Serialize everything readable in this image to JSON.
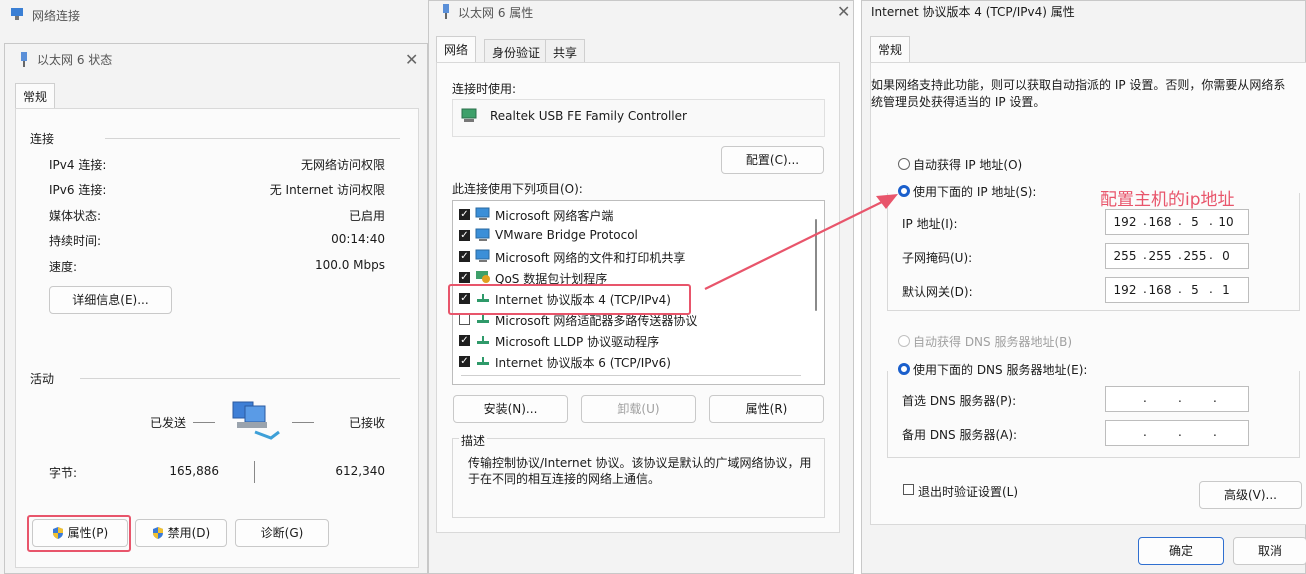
{
  "bg_window": {
    "title": "网络连接"
  },
  "status_window": {
    "title": "以太网 6 状态",
    "tab": "常规",
    "connection": {
      "heading": "连接",
      "rows": [
        {
          "label": "IPv4 连接:",
          "value": "无网络访问权限"
        },
        {
          "label": "IPv6 连接:",
          "value": "无 Internet 访问权限"
        },
        {
          "label": "媒体状态:",
          "value": "已启用"
        },
        {
          "label": "持续时间:",
          "value": "00:14:40"
        },
        {
          "label": "速度:",
          "value": "100.0 Mbps"
        }
      ],
      "details_button": "详细信息(E)..."
    },
    "activity": {
      "heading": "活动",
      "sent_label": "已发送",
      "received_label": "已接收",
      "bytes_label": "字节:",
      "bytes_sent": "165,886",
      "bytes_received": "612,340"
    },
    "buttons": {
      "properties": "属性(P)",
      "disable": "禁用(D)",
      "diagnose": "诊断(G)"
    }
  },
  "props_window": {
    "title": "以太网 6 属性",
    "tabs": [
      "网络",
      "身份验证",
      "共享"
    ],
    "connect_using_label": "连接时使用:",
    "adapter_name": "Realtek USB FE Family Controller",
    "configure_button": "配置(C)...",
    "items_label": "此连接使用下列项目(O):",
    "items": [
      {
        "text": "Microsoft 网络客户端",
        "checked": true,
        "icon": "network-client-icon"
      },
      {
        "text": "VMware Bridge Protocol",
        "checked": true,
        "icon": "network-client-icon"
      },
      {
        "text": "Microsoft 网络的文件和打印机共享",
        "checked": true,
        "icon": "network-client-icon"
      },
      {
        "text": "QoS 数据包计划程序",
        "checked": true,
        "icon": "qos-icon"
      },
      {
        "text": "Internet 协议版本 4 (TCP/IPv4)",
        "checked": true,
        "icon": "protocol-icon"
      },
      {
        "text": "Microsoft 网络适配器多路传送器协议",
        "checked": false,
        "icon": "protocol-icon"
      },
      {
        "text": "Microsoft LLDP 协议驱动程序",
        "checked": true,
        "icon": "protocol-icon"
      },
      {
        "text": "Internet 协议版本 6 (TCP/IPv6)",
        "checked": true,
        "icon": "protocol-icon"
      }
    ],
    "install_button": "安装(N)...",
    "uninstall_button": "卸载(U)",
    "properties_button": "属性(R)",
    "description_label": "描述",
    "description_text": "传输控制协议/Internet 协议。该协议是默认的广域网络协议，用于在不同的相互连接的网络上通信。"
  },
  "ipv4_window": {
    "title": "Internet 协议版本 4 (TCP/IPv4) 属性",
    "tab": "常规",
    "intro": "如果网络支持此功能，则可以获取自动指派的 IP 设置。否则，你需要从网络系统管理员处获得适当的 IP 设置。",
    "auto_ip_label": "自动获得 IP 地址(O)",
    "manual_ip_label": "使用下面的 IP 地址(S):",
    "ip_label": "IP 地址(I):",
    "mask_label": "子网掩码(U):",
    "gateway_label": "默认网关(D):",
    "ip": [
      "192",
      "168",
      "5",
      "10"
    ],
    "mask": [
      "255",
      "255",
      "255",
      "0"
    ],
    "gateway": [
      "192",
      "168",
      "5",
      "1"
    ],
    "auto_dns_label": "自动获得 DNS 服务器地址(B)",
    "manual_dns_label": "使用下面的 DNS 服务器地址(E):",
    "preferred_dns_label": "首选 DNS 服务器(P):",
    "alternate_dns_label": "备用 DNS 服务器(A):",
    "validate_label": "退出时验证设置(L)",
    "advanced_button": "高级(V)...",
    "ok_button": "确定",
    "cancel_button": "取消"
  },
  "annotation": {
    "text": "配置主机的ip地址",
    "color": "#e8556b"
  }
}
